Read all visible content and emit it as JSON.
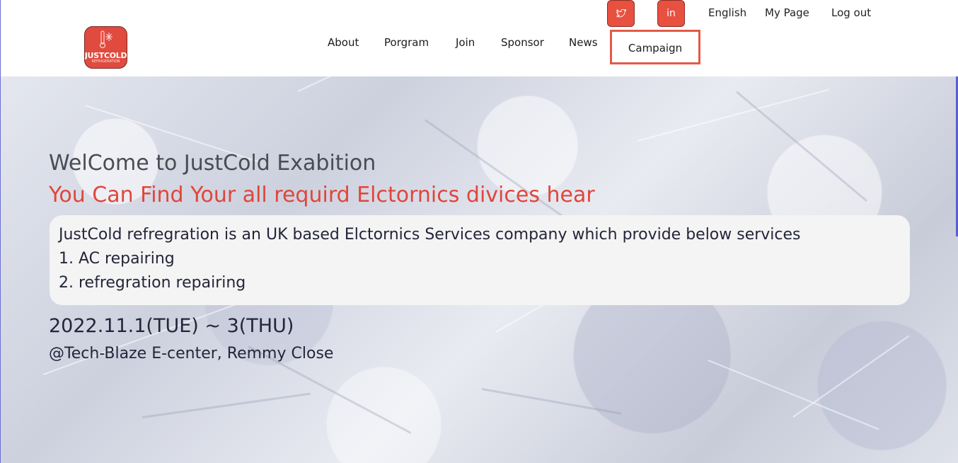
{
  "brand": {
    "logo_text": "JUSTCOLD",
    "logo_subtext": "REFRIGERATION",
    "accent_color": "#e04a3f"
  },
  "header": {
    "social": [
      {
        "name": "twitter",
        "icon": "twitter-icon"
      },
      {
        "name": "linkedin",
        "icon": "linkedin-icon",
        "glyph": "in"
      }
    ],
    "utility_links": {
      "language": "English",
      "my_page": "My Page",
      "logout": "Log out"
    },
    "nav": {
      "about": "About",
      "program": "Porgram",
      "join": "Join",
      "sponsor": "Sponsor",
      "news": "News",
      "campaign": "Campaign"
    },
    "highlight_color": "#e25a47"
  },
  "hero": {
    "welcome": "WelCome to JustCold Exabition",
    "tagline": "You Can Find Your all requird Elctornics divices hear",
    "info": {
      "line1": "JustCold refregration is an UK based Elctornics Services company which provide below services",
      "line2": "1. AC repairing",
      "line3": "2. refregration repairing"
    },
    "date": "2022.11.1(TUE) ~ 3(THU)",
    "venue": "@Tech-Blaze E-center, Remmy Close",
    "tagline_color": "#e0463b"
  }
}
